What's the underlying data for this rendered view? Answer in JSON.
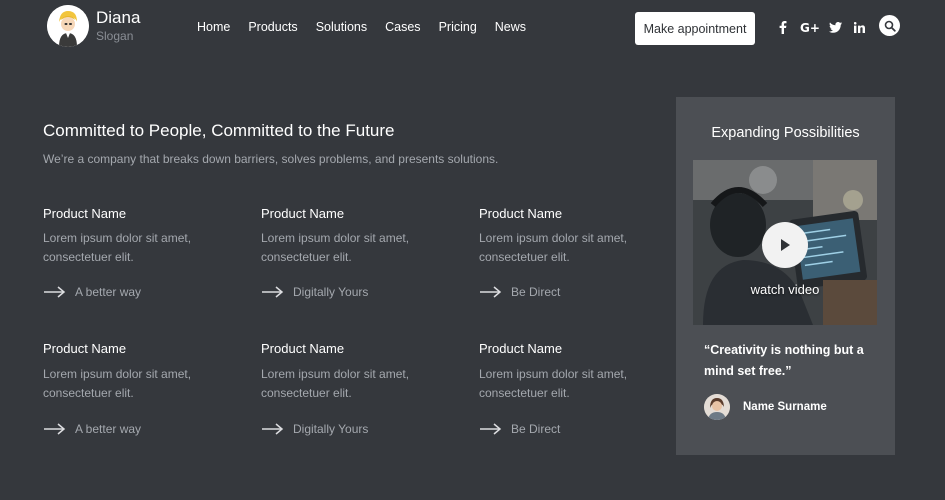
{
  "header": {
    "brand_name": "Diana",
    "brand_slogan": "Slogan",
    "nav": [
      "Home",
      "Products",
      "Solutions",
      "Cases",
      "Pricing",
      "News"
    ],
    "appointment_label": "Make appointment",
    "social_icons": [
      "facebook-icon",
      "google-plus-icon",
      "twitter-icon",
      "linkedin-icon"
    ],
    "search_icon": "search-icon"
  },
  "main": {
    "title": "Committed to People, Committed to the Future",
    "subtitle": "We’re a company that breaks down barriers, solves problems, and presents solutions.",
    "products": [
      {
        "name": "Product Name",
        "desc_line1": "Lorem ipsum dolor sit amet,",
        "desc_line2": "consectetuer elit.",
        "link": "A better way"
      },
      {
        "name": "Product Name",
        "desc_line1": "Lorem ipsum dolor sit amet,",
        "desc_line2": "consectetuer elit.",
        "link": "Digitally Yours"
      },
      {
        "name": "Product Name",
        "desc_line1": "Lorem ipsum dolor sit amet,",
        "desc_line2": "consectetuer elit.",
        "link": "Be Direct"
      },
      {
        "name": "Product Name",
        "desc_line1": "Lorem ipsum dolor sit amet,",
        "desc_line2": "consectetuer elit.",
        "link": "A better way"
      },
      {
        "name": "Product Name",
        "desc_line1": "Lorem ipsum dolor sit amet,",
        "desc_line2": "consectetuer elit.",
        "link": "Digitally Yours"
      },
      {
        "name": "Product Name",
        "desc_line1": "Lorem ipsum dolor sit amet,",
        "desc_line2": "consectetuer elit.",
        "link": "Be Direct"
      }
    ]
  },
  "card": {
    "title": "Expanding Possibilities",
    "video_label": "watch video",
    "quote": "“Creativity is nothing but a mind set free.”",
    "author": "Name Surname"
  },
  "colors": {
    "background": "#35383d",
    "card_background": "#4c4f54",
    "muted_text": "#a4a8ae",
    "button_background": "#ffffff"
  }
}
